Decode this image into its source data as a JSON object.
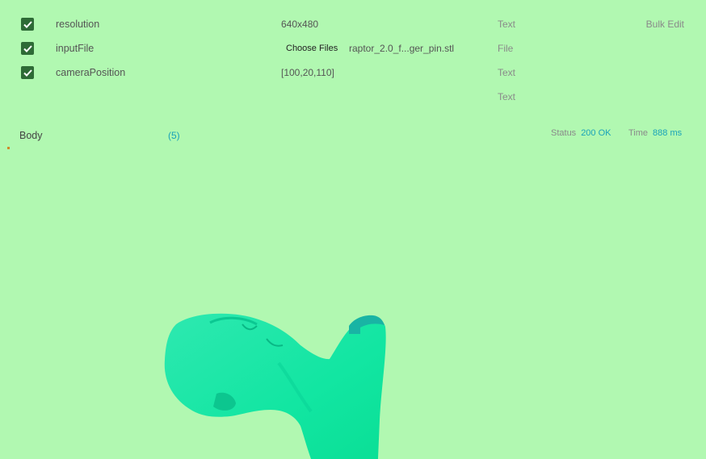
{
  "params": {
    "bulk_edit": "Bulk Edit",
    "rows": [
      {
        "key": "resolution",
        "value": "640x480",
        "type": "Text"
      },
      {
        "key": "inputFile",
        "button": "Choose Files",
        "file": "raptor_2.0_f...ger_pin.stl",
        "type": "File"
      },
      {
        "key": "cameraPosition",
        "value": "[100,20,110]",
        "type": "Text"
      },
      {
        "type": "Text"
      }
    ]
  },
  "response": {
    "body_label": "Body",
    "body_count": "(5)",
    "status_label": "Status",
    "status_value": "200 OK",
    "time_label": "Time",
    "time_value": "888 ms"
  },
  "colors": {
    "background": "#b1f8b1",
    "checkbox": "#2e6b36",
    "accent": "#1aa3b8",
    "model": "#1fe8a4"
  },
  "icons": {
    "checkbox": "check-icon"
  }
}
